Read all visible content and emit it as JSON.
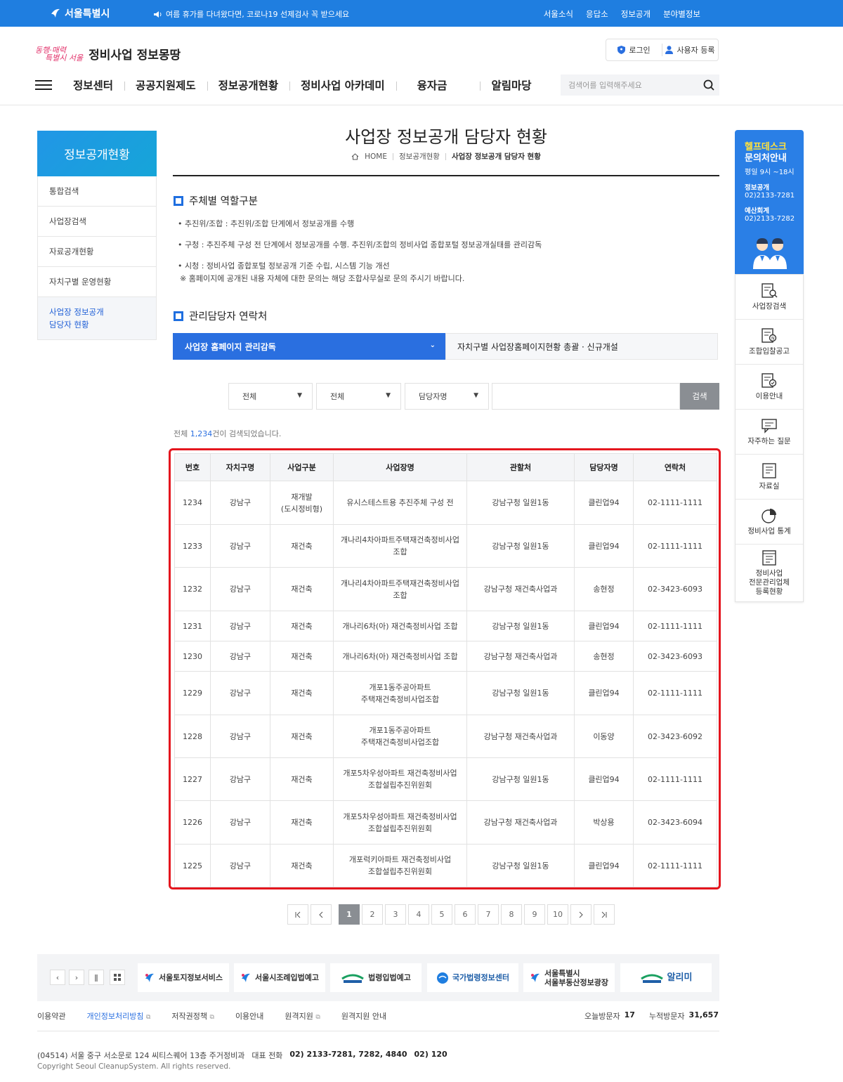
{
  "topbar": {
    "logo": "서울특별시",
    "notice": "여름 휴가를 다녀왔다면, 코로나19 선제검사 꼭 받으세요",
    "links": [
      "서울소식",
      "응답소",
      "정보공개",
      "분야별정보"
    ]
  },
  "header": {
    "brand_logo_line1": "동행·매력",
    "brand_logo_line2": "특별시 서울",
    "brand_name": "정비사업 정보몽땅",
    "login": "로그인",
    "register": "사용자 등록",
    "gnb": [
      "정보센터",
      "공공지원제도",
      "정보공개현황",
      "정비사업 아카데미",
      "융자금",
      "알림마당"
    ],
    "search_placeholder": "검색어를 입력해주세요"
  },
  "lnb": {
    "title": "정보공개현황",
    "items": [
      "통합검색",
      "사업장검색",
      "자료공개현황",
      "자치구별 운영현황"
    ],
    "active_line1": "사업장 정보공개",
    "active_line2": "담당자 현황"
  },
  "page": {
    "title": "사업장 정보공개 담당자 현황",
    "breadcrumb": [
      "HOME",
      "정보공개현황",
      "사업장 정보공개 담당자 현황"
    ],
    "sec1_title": "주체별 역할구분",
    "sec1_items": [
      "• 추진위/조합 : 추진위/조합 단계에서 정보공개를 수행",
      "• 구청 : 추진주체 구성 전 단계에서 정보공개를 수행. 추진위/조합의 정비사업 종합포털 정보공개실태를 관리감독",
      "• 시청 : 정비사업 종합포털 정보공개 기준 수립, 시스템 기능 개선",
      "※ 홈페이지에 공개된 내용 자체에 대한 문의는 해당 조합사무실로 문의 주시기 바랍니다."
    ],
    "sec2_title": "관리담당자 연락처",
    "tab_active": "사업장 홈페이지 관리감독",
    "tab_inactive": "자치구별 사업장홈페이지현황 총괄 · 신규개설",
    "filter1": "전체",
    "filter2": "전체",
    "filter3": "담당자명",
    "search_button": "검색",
    "count_prefix": "전체 ",
    "count_value": "1,234",
    "count_suffix": "건이 검색되었습니다."
  },
  "table": {
    "headers": [
      "번호",
      "자치구명",
      "사업구분",
      "사업장명",
      "관할처",
      "담당자명",
      "연락처"
    ],
    "rows": [
      [
        "1234",
        "강남구",
        "재개발\n(도시정비형)",
        "유시스테스트용 추진주체 구성 전",
        "강남구청 일원1동",
        "클린업94",
        "02-1111-1111"
      ],
      [
        "1233",
        "강남구",
        "재건축",
        "개나리4차아파트주택재건축정비사업\n조합",
        "강남구청 일원1동",
        "클린업94",
        "02-1111-1111"
      ],
      [
        "1232",
        "강남구",
        "재건축",
        "개나리4차아파트주택재건축정비사업\n조합",
        "강남구청 재건축사업과",
        "송현정",
        "02-3423-6093"
      ],
      [
        "1231",
        "강남구",
        "재건축",
        "개나리6차(아) 재건축정비사업 조합",
        "강남구청 일원1동",
        "클린업94",
        "02-1111-1111"
      ],
      [
        "1230",
        "강남구",
        "재건축",
        "개나리6차(아) 재건축정비사업 조합",
        "강남구청 재건축사업과",
        "송현정",
        "02-3423-6093"
      ],
      [
        "1229",
        "강남구",
        "재건축",
        "개포1동주공아파트\n주택재건축정비사업조합",
        "강남구청 일원1동",
        "클린업94",
        "02-1111-1111"
      ],
      [
        "1228",
        "강남구",
        "재건축",
        "개포1동주공아파트\n주택재건축정비사업조합",
        "강남구청 재건축사업과",
        "이동양",
        "02-3423-6092"
      ],
      [
        "1227",
        "강남구",
        "재건축",
        "개포5차우성아파트 재건축정비사업\n조합설립추진위원회",
        "강남구청 일원1동",
        "클린업94",
        "02-1111-1111"
      ],
      [
        "1226",
        "강남구",
        "재건축",
        "개포5차우성아파트 재건축정비사업\n조합설립추진위원회",
        "강남구청 재건축사업과",
        "박상용",
        "02-3423-6094"
      ],
      [
        "1225",
        "강남구",
        "재건축",
        "개포럭키아파트 재건축정비사업\n조합설립추진위원회",
        "강남구청 일원1동",
        "클린업94",
        "02-1111-1111"
      ]
    ]
  },
  "pagination": {
    "pages": [
      "1",
      "2",
      "3",
      "4",
      "5",
      "6",
      "7",
      "8",
      "9",
      "10"
    ],
    "current": "1"
  },
  "helpdesk": {
    "title1": "헬프데스크",
    "title2": "문의처안내",
    "hours": "평일 9시 ~18시",
    "label1": "정보공개",
    "tel1": "02)2133-7281",
    "label2": "예산회계",
    "tel2": "02)2133-7282"
  },
  "quick": [
    {
      "line1": "사업장검색",
      "line2": "",
      "line3": ""
    },
    {
      "line1": "조합입찰공고",
      "line2": "",
      "line3": ""
    },
    {
      "line1": "이용안내",
      "line2": "",
      "line3": ""
    },
    {
      "line1": "자주하는 질문",
      "line2": "",
      "line3": ""
    },
    {
      "line1": "자료실",
      "line2": "",
      "line3": ""
    },
    {
      "line1": "정비사업 통계",
      "line2": "",
      "line3": ""
    },
    {
      "line1": "정비사업",
      "line2": "전문관리업체",
      "line3": "등록현황"
    }
  ],
  "banners": [
    {
      "line1": "서울토지정보서비스",
      "line2": ""
    },
    {
      "line1": "서울시조례입법예고",
      "line2": ""
    },
    {
      "line1": "법령입법예고",
      "line2": ""
    },
    {
      "line1": "국가법령정보센터",
      "line2": ""
    },
    {
      "line1": "서울특별시",
      "line2": "서울부동산정보광장"
    },
    {
      "line1": "알리미",
      "line2": ""
    }
  ],
  "footer": {
    "links": [
      "이용약관",
      "개인정보처리방침",
      "저작권정책",
      "이용안내",
      "원격지원",
      "원격지원 안내"
    ],
    "today_label": "오늘방문자",
    "today_value": "17",
    "total_label": "누적방문자",
    "total_value": "31,657",
    "address": "(04514) 서울 중구 서소문로 124 씨티스퀘어 13층 주거정비과",
    "rep_label": "대표 전화",
    "rep_tel": "02) 2133-7281, 7282, 4840",
    "rep_tel2": "02) 120",
    "copyright": "Copyright Seoul CleanupSystem. All rights reserved."
  },
  "colors": {
    "primary": "#1f7ee0",
    "tab": "#2a6fe0",
    "highlight_frame": "#e4161e",
    "button_gray": "#8a8e93"
  }
}
